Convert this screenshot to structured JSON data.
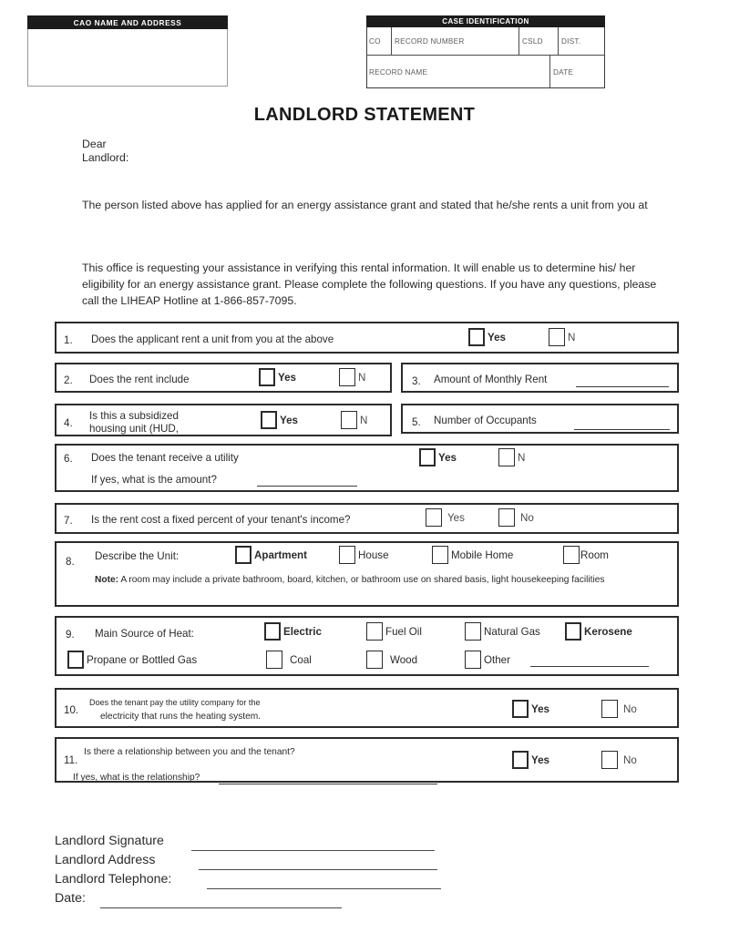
{
  "header": {
    "cao": {
      "bar_title": "CAO NAME AND ADDRESS",
      "value": ""
    },
    "case": {
      "bar_title": "CASE IDENTIFICATION",
      "row1": [
        {
          "label": "CO",
          "value": ""
        },
        {
          "label": "RECORD NUMBER",
          "value": ""
        },
        {
          "label": "CSLD",
          "value": ""
        },
        {
          "label": "DIST.",
          "value": ""
        }
      ],
      "row2": [
        {
          "label": "RECORD NAME",
          "value": ""
        },
        {
          "label": "DATE",
          "value": ""
        }
      ]
    }
  },
  "title": "LANDLORD STATEMENT",
  "letter": {
    "greeting_line1": "Dear",
    "greeting_line2": "Landlord:",
    "paragraph1": "The person listed above has applied for an energy assistance grant and stated that he/she rents a unit from   you at",
    "paragraph2": "This office is requesting your assistance in verifying this rental information. It will enable us to determine his/ her eligibility for an energy assistance grant. Please complete the following questions. If you have any questions, please call the LIHEAP Hotline at 1-866-857-7095."
  },
  "questions": {
    "q1": {
      "number": "1.",
      "text": "Does the applicant rent a unit from you at the above",
      "yes_label": "Yes",
      "no_label": "N"
    },
    "q2": {
      "number": "2.",
      "text": "Does the rent include",
      "yes_label": "Yes",
      "no_label": "N"
    },
    "q3": {
      "number": "3.",
      "text": "Amount of Monthly Rent",
      "value": ""
    },
    "q4": {
      "number": "4.",
      "text_line1": "Is this a subsidized",
      "text_line2": "housing unit (HUD,",
      "yes_label": "Yes",
      "no_label": "N"
    },
    "q5": {
      "number": "5.",
      "text": "Number of Occupants",
      "value": ""
    },
    "q6": {
      "number": "6.",
      "text": "Does the tenant receive a utility",
      "yes_label": "Yes",
      "no_label": "N",
      "followup": "If yes, what is the amount?",
      "followup_value": ""
    },
    "q7": {
      "number": "7.",
      "text": "Is the rent cost a fixed percent of your  tenant's income?",
      "yes_label": "Yes",
      "no_label": "No"
    },
    "q8": {
      "number": "8.",
      "text": "Describe the Unit:",
      "options": [
        "Apartment",
        "House",
        "Mobile Home",
        "Room"
      ],
      "note_label": "Note:",
      "note_text": "A room may include a private bathroom, board, kitchen, or bathroom use on  shared basis, light housekeeping facilities"
    },
    "q9": {
      "number": "9.",
      "text": "Main Source of Heat:",
      "row1": [
        "Electric",
        "Fuel Oil",
        "Natural Gas",
        "Kerosene"
      ],
      "row2": [
        "Propane or Bottled Gas",
        "Coal",
        "Wood",
        "Other"
      ],
      "other_value": ""
    },
    "q10": {
      "number": "10.",
      "text_line1": "Does the tenant pay the utility company for  the",
      "text_line2": "electricity that runs the heating system.",
      "yes_label": "Yes",
      "no_label": "No"
    },
    "q11": {
      "number": "11.",
      "text": "Is there a relationship between you and the  tenant?",
      "yes_label": "Yes",
      "no_label": "No",
      "followup": "If yes, what is the relationship?",
      "followup_value": ""
    }
  },
  "signature_block": {
    "signature_label": "Landlord Signature",
    "address_label": "Landlord Address",
    "telephone_label": "Landlord Telephone:",
    "date_label": "Date:",
    "signature_value": "",
    "address_value": "",
    "telephone_value": "",
    "date_value": ""
  },
  "colors": {
    "ink": "#2b2b2b",
    "bar_bg": "#1c1c1c",
    "bar_text": "#ffffff",
    "page_bg": "#ffffff"
  }
}
